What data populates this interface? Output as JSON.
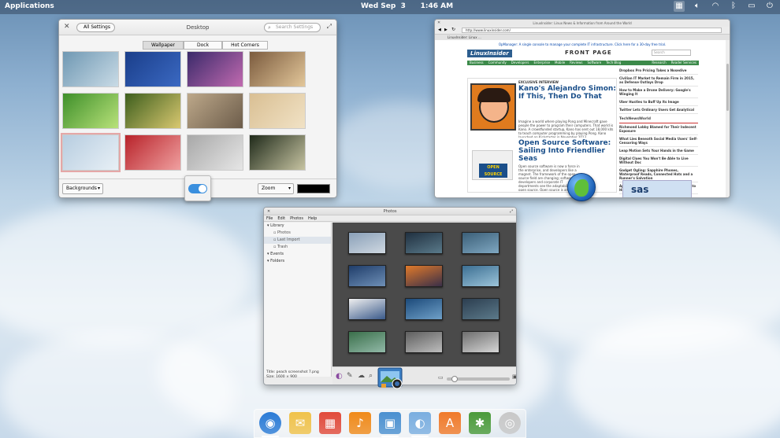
{
  "panel": {
    "applications_label": "Applications",
    "datetime": "Wed Sep  3      1:46 AM",
    "tray_icons": [
      "window-switcher-icon",
      "volume-icon",
      "wifi-icon",
      "bluetooth-icon",
      "battery-icon",
      "power-icon"
    ]
  },
  "settings": {
    "all_settings_label": "All Settings",
    "title": "Desktop",
    "search_placeholder": "Search Settings",
    "tabs": [
      {
        "label": "Wallpaper",
        "active": true
      },
      {
        "label": "Dock",
        "active": false
      },
      {
        "label": "Hot Corners",
        "active": false
      }
    ],
    "wallpapers": [
      {
        "colors": [
          "#6f98b3",
          "#c9dbe6"
        ],
        "selected": false
      },
      {
        "colors": [
          "#1a3e8a",
          "#3b69c2"
        ],
        "selected": false
      },
      {
        "colors": [
          "#3a2a6a",
          "#c16ab0"
        ],
        "selected": false
      },
      {
        "colors": [
          "#7b5b3e",
          "#e3c79a"
        ],
        "selected": false
      },
      {
        "colors": [
          "#3e8f2a",
          "#b9e27a"
        ],
        "selected": false
      },
      {
        "colors": [
          "#3d5e1d",
          "#d9c870"
        ],
        "selected": false
      },
      {
        "colors": [
          "#bda88a",
          "#6c5c4a"
        ],
        "selected": false
      },
      {
        "colors": [
          "#d9bf93",
          "#f1e2c5"
        ],
        "selected": false
      },
      {
        "colors": [
          "#b7cde0",
          "#e8f0f6"
        ],
        "selected": true
      },
      {
        "colors": [
          "#b8232a",
          "#f0a0a0"
        ],
        "selected": false
      },
      {
        "colors": [
          "#a8a8a8",
          "#e6e6e6"
        ],
        "selected": false
      },
      {
        "colors": [
          "#1f2a1a",
          "#c7c4a2"
        ],
        "selected": false
      }
    ],
    "mode_dropdown": "Backgrounds",
    "fit_dropdown": "Zoom",
    "background_color": "#000000"
  },
  "browser": {
    "window_title": "LinuxInsider: Linux News & Information from Around the World",
    "url": "http://www.linuxinsider.com/",
    "tab_label": "LinuxInsider: Linux ...",
    "promo": "OpManager: A single console to manage your complete IT infrastructure. Click here for a 30-day free trial.",
    "logo": "LinuxInsider",
    "front_page": "FRONT PAGE",
    "search_placeholder": "Search",
    "nav_left": [
      "Business",
      "Community",
      "Developers",
      "Enterprise",
      "Mobile",
      "Reviews",
      "Software",
      "Tech Blog"
    ],
    "nav_right": [
      "Research",
      "Reader Services"
    ],
    "articles": [
      {
        "kicker": "EXCLUSIVE INTERVIEW",
        "title": "Kano's Alejandro Simon: If This, Then Do That",
        "teaser": "Imagine a world where playing Pong and Minecraft gave people the power to program their computers. That world is Kano. A crowdfunded startup, Kano has sent out 18,000 kits to teach computer programming by playing Pong. Kano launched on Kickstarter in November 2013."
      },
      {
        "kicker": "",
        "title": "Open Source Software: Sailing Into Friendlier Seas",
        "teaser": "Open source software is now a force in the enterprise, and developers like a magnet. The framework of the open source field are changing; software developers and corporate IT departments see the adaptability of open source. Open source is an increasingly important within the corporation."
      }
    ],
    "sidebar_items": [
      "Dropbox Pro Pricing Takes a Nosedive",
      "Civilian IT Market to Remain Firm in 2015, as Defense Outlays Drop",
      "How to Make a Drone Delivery: Google's Winging It",
      "Uber Hustles to Buff Up Its Image",
      "Twitter Lets Ordinary Users Get Analytical"
    ],
    "sidebar_head": "TechNewsWorld",
    "sidebar_items_2": [
      "Richmond Lobby Blamed for Their Indecent Exposure",
      "What Lies Beneath Social Media Users' Self-Censoring Ways",
      "Leap Motion Sets Your Hands in the Game",
      "Digital Clues You Won't Be Able to Live Without Doc",
      "Gadget Ogling: Sapphire Phones, Waterproof Reads, Connected Hats and a Runner's Salvation",
      "Apple's Move to Kick Mobile Payments Into High Gear"
    ],
    "ad_label": "sas"
  },
  "photos": {
    "title": "Photos",
    "menu": [
      "File",
      "Edit",
      "Photos",
      "Help"
    ],
    "sidebar": [
      {
        "label": "Library",
        "level": 0,
        "selected": false
      },
      {
        "label": "Photos",
        "level": 1,
        "selected": false
      },
      {
        "label": "Last Import",
        "level": 1,
        "selected": true
      },
      {
        "label": "Trash",
        "level": 1,
        "selected": false
      },
      {
        "label": "Events",
        "level": 0,
        "selected": false
      },
      {
        "label": "Folders",
        "level": 0,
        "selected": false
      }
    ],
    "status_title": "Title: peach screenshot 7.png",
    "status_size": "Size: 1600 × 900",
    "thumbs": [
      [
        "#8aa0b8",
        "#cfd8e1"
      ],
      [
        "#203040",
        "#5a7a8a"
      ],
      [
        "#3b5f78",
        "#7fa7c1"
      ],
      [
        "#1f3d6a",
        "#6e8fb6"
      ],
      [
        "#e17a2a",
        "#3a2f48"
      ],
      [
        "#3c6f93",
        "#9cc4d9"
      ],
      [
        "#f0f0f0",
        "#3a5a8a"
      ],
      [
        "#1c4a7a",
        "#6fa0c8"
      ],
      [
        "#2c3e50",
        "#5c7a8a"
      ],
      [
        "#3a6f4a",
        "#92b9a8"
      ],
      [
        "#5e5e5e",
        "#bdbdbd"
      ],
      [
        "#6e6e6e",
        "#d6d6d6"
      ]
    ]
  },
  "dock": {
    "items": [
      {
        "name": "browser",
        "color": "#2a7bd6",
        "running": true
      },
      {
        "name": "mail",
        "color": "#f0c24a",
        "running": false
      },
      {
        "name": "calendar",
        "color": "#e14a3a",
        "running": false
      },
      {
        "name": "music",
        "color": "#f08a1a",
        "running": false
      },
      {
        "name": "photos",
        "color": "#4a90d0",
        "running": true
      },
      {
        "name": "settings",
        "color": "#7aaee0",
        "running": true
      },
      {
        "name": "app-center",
        "color": "#f07a2a",
        "running": false
      },
      {
        "name": "bug-tracker",
        "color": "#4a9a3a",
        "running": false
      },
      {
        "name": "software-installer",
        "color": "#c8c8c8",
        "running": false
      }
    ]
  }
}
